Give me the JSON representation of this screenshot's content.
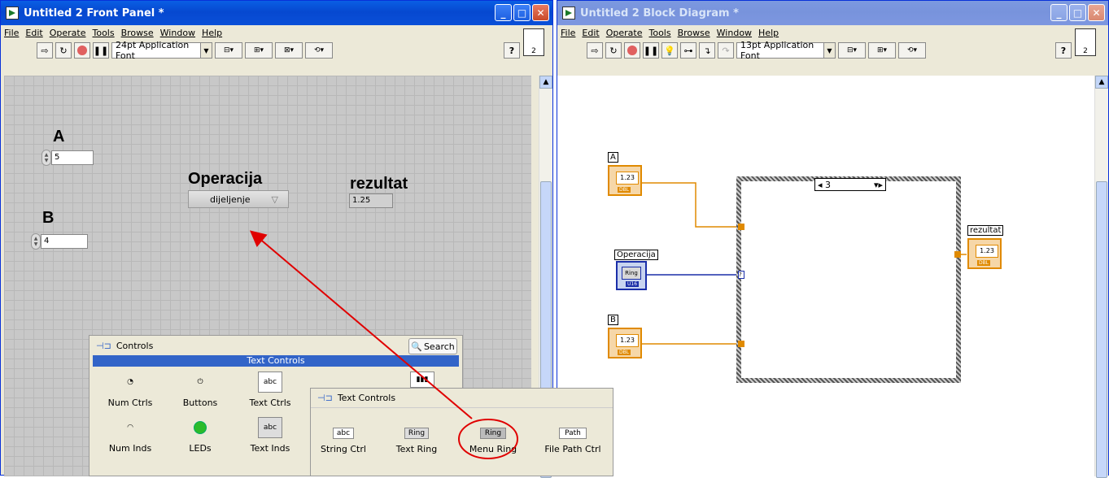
{
  "front_panel": {
    "title": "Untitled 2 Front Panel *",
    "menu": [
      "File",
      "Edit",
      "Operate",
      "Tools",
      "Browse",
      "Window",
      "Help"
    ],
    "font_selector": "24pt Application Font",
    "help_glyph": "?",
    "corner_number": "2",
    "controls": {
      "a_label": "A",
      "a_value": "5",
      "b_label": "B",
      "b_value": "4",
      "op_label": "Operacija",
      "op_value": "dijeljenje",
      "result_label": "rezultat",
      "result_value": "1.25"
    }
  },
  "controls_palette": {
    "title": "Controls",
    "search_label": "Search",
    "category_header": "Text Controls",
    "items": [
      "Num Ctrls",
      "Buttons",
      "Text Ctrls",
      "Num Inds",
      "LEDs",
      "Text Inds"
    ]
  },
  "text_controls_palette": {
    "title": "Text Controls",
    "items": [
      "String Ctrl",
      "Text Ring",
      "Menu Ring",
      "File Path Ctrl"
    ],
    "icon_texts": [
      "abc",
      "Ring",
      "Ring",
      "Path"
    ]
  },
  "block_diagram": {
    "title": "Untitled 2 Block Diagram *",
    "menu": [
      "File",
      "Edit",
      "Operate",
      "Tools",
      "Browse",
      "Window",
      "Help"
    ],
    "font_selector": "13pt Application Font",
    "help_glyph": "?",
    "corner_number": "2",
    "terminals": {
      "a_label": "A",
      "b_label": "B",
      "op_label": "Operacija",
      "result_label": "rezultat",
      "dbl_text": "1.23",
      "dbl_tag": "DBL",
      "ring_text": "Ring",
      "u16_tag": "U16"
    },
    "case_selector": "3",
    "divide_symbol": "÷"
  },
  "colors": {
    "title_active": "#0a5fe4",
    "annotation_arrow": "#e00000",
    "wire_dbl": "#e08a00",
    "wire_u16": "#1a2ea8"
  }
}
